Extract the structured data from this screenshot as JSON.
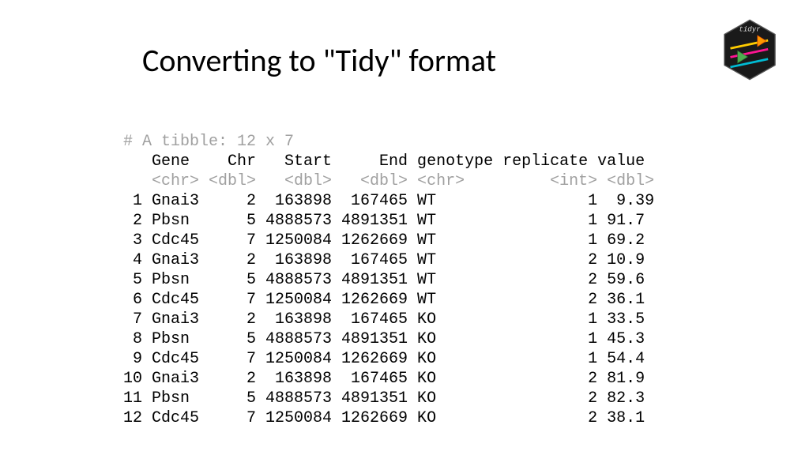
{
  "title": "Converting to \"Tidy\" format",
  "tibble_header": "# A tibble: 12 x 7",
  "col_header": "   Gene    Chr   Start     End genotype replicate value",
  "col_types": "   <chr> <dbl>   <dbl>   <dbl> <chr>         <int> <dbl>",
  "rows": [
    " 1 Gnai3     2  163898  167465 WT                1  9.39",
    " 2 Pbsn      5 4888573 4891351 WT                1 91.7 ",
    " 3 Cdc45     7 1250084 1262669 WT                1 69.2 ",
    " 4 Gnai3     2  163898  167465 WT                2 10.9 ",
    " 5 Pbsn      5 4888573 4891351 WT                2 59.6 ",
    " 6 Cdc45     7 1250084 1262669 WT                2 36.1 ",
    " 7 Gnai3     2  163898  167465 KO                1 33.5 ",
    " 8 Pbsn      5 4888573 4891351 KO                1 45.3 ",
    " 9 Cdc45     7 1250084 1262669 KO                1 54.4 ",
    "10 Gnai3     2  163898  167465 KO                2 81.9 ",
    "11 Pbsn      5 4888573 4891351 KO                2 82.3 ",
    "12 Cdc45     7 1250084 1262669 KO                2 38.1 "
  ],
  "logo_label": "tidyr"
}
